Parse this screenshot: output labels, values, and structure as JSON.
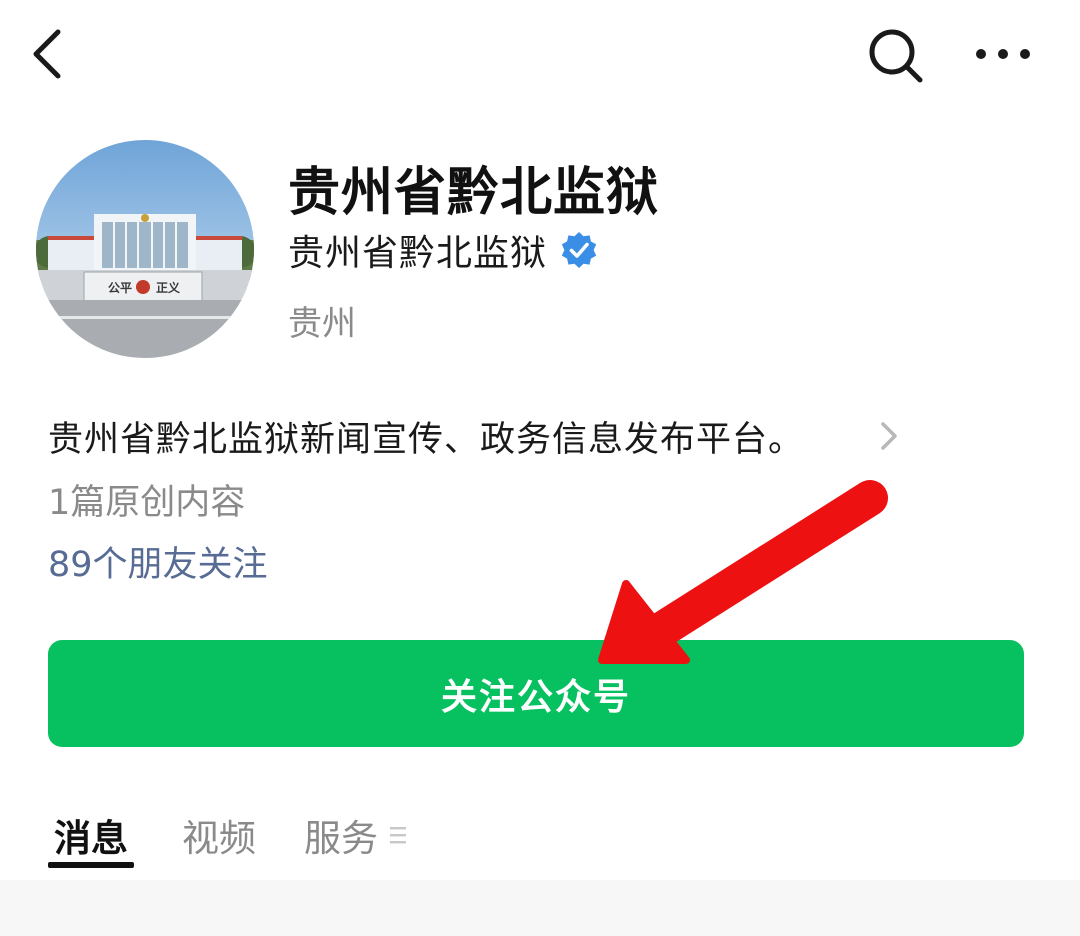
{
  "topbar": {
    "back_icon": "chevron-left-icon",
    "search_icon": "search-icon",
    "more_icon": "more-dots-icon"
  },
  "profile": {
    "avatar_sign_left": "公平",
    "avatar_sign_right": "正义",
    "title": "贵州省黔北监狱",
    "account_name": "贵州省黔北监狱",
    "verified_icon": "verified-badge-icon",
    "region": "贵州",
    "bio": "贵州省黔北监狱新闻宣传、政务信息发布平台。",
    "original_count": "1篇原创内容",
    "friends_follow": "89个朋友关注"
  },
  "follow_button": {
    "label": "关注公众号"
  },
  "tabs": [
    {
      "label": "消息",
      "active": true
    },
    {
      "label": "视频",
      "active": false
    },
    {
      "label": "服务",
      "active": false
    }
  ],
  "colors": {
    "accent_green": "#07c160",
    "link_blue": "#576b95",
    "verified_blue": "#3a8ee6",
    "annotation_red": "#ee1111"
  }
}
